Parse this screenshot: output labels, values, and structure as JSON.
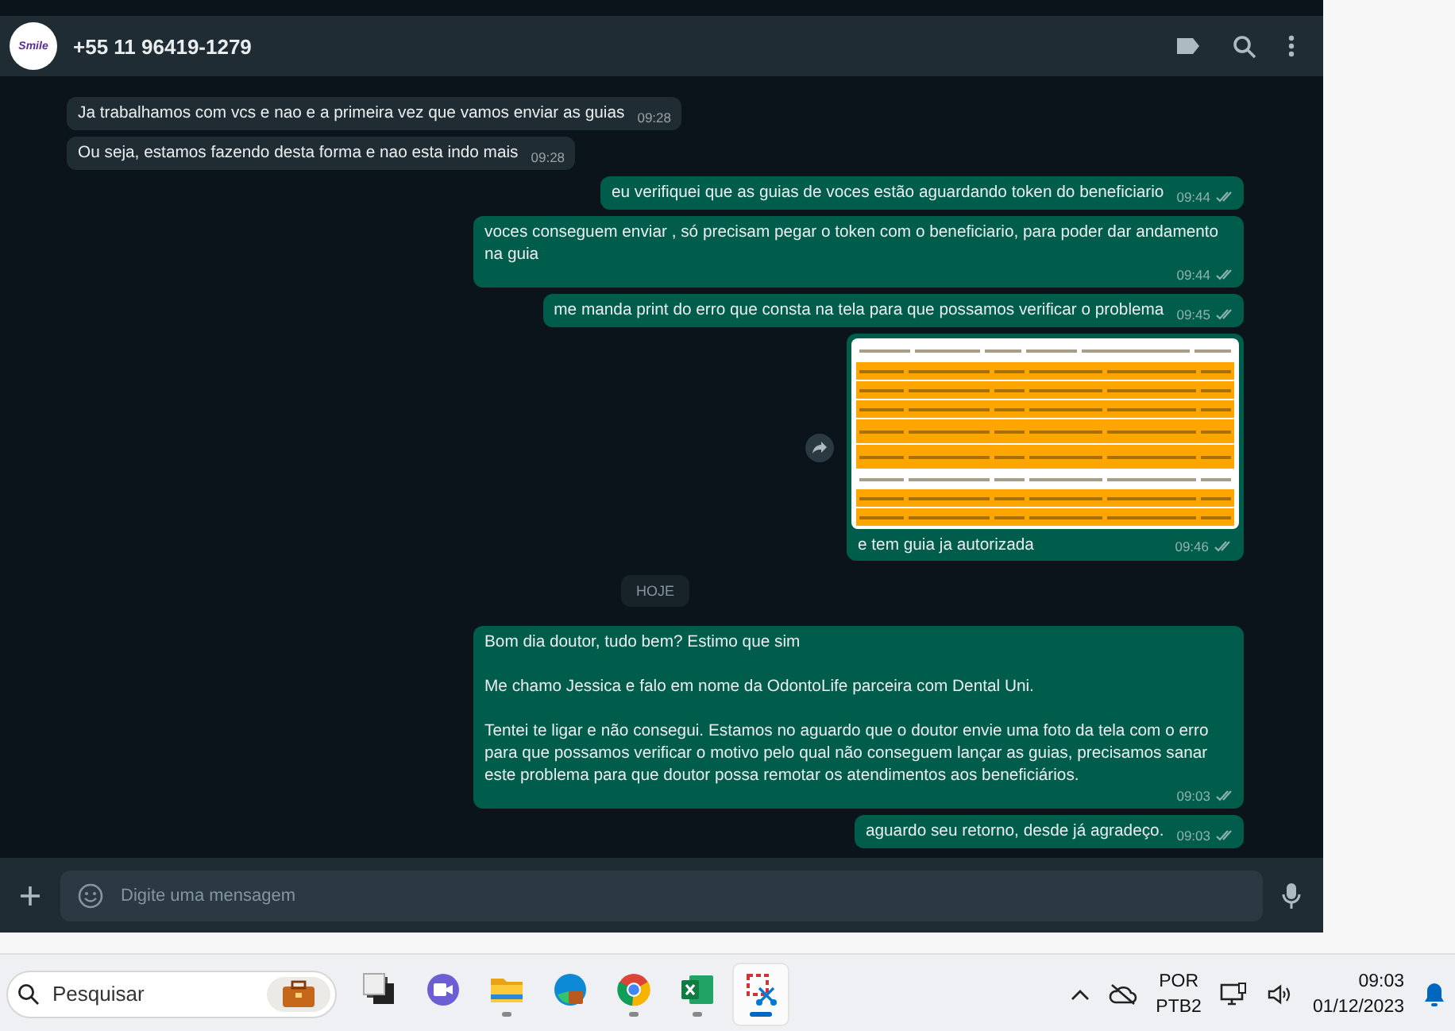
{
  "chat_header": {
    "avatar_text": "Smile",
    "title": "+55 11 96419-1279"
  },
  "messages": [
    {
      "kind": "text",
      "outgoing": false,
      "text": "Ja trabalhamos com vcs e nao e a primeira vez que vamos enviar as guias",
      "time": "09:28"
    },
    {
      "kind": "text",
      "outgoing": false,
      "text": "Ou seja, estamos fazendo desta forma e nao esta indo mais",
      "time": "09:28"
    },
    {
      "kind": "text",
      "outgoing": true,
      "text": "eu verifiquei que as guias de voces estão aguardando token do beneficiario",
      "time": "09:44",
      "read": false
    },
    {
      "kind": "text",
      "outgoing": true,
      "text": "voces conseguem enviar , só precisam pegar o token com o beneficiario, para poder dar andamento na guia",
      "time": "09:44",
      "read": false
    },
    {
      "kind": "text",
      "outgoing": true,
      "text": "me manda print do erro que consta na tela para que possamos verificar o problema",
      "time": "09:45",
      "read": false
    },
    {
      "kind": "image",
      "outgoing": true,
      "text": "e tem guia ja autorizada",
      "time": "09:46",
      "read": false,
      "thumbnail_rows": [
        {
          "highlighted": true
        },
        {
          "highlighted": true
        },
        {
          "highlighted": true
        },
        {
          "highlighted": true
        },
        {
          "highlighted": true
        },
        {
          "highlighted": false
        },
        {
          "highlighted": true
        },
        {
          "highlighted": true
        }
      ]
    },
    {
      "kind": "date",
      "text": "HOJE"
    },
    {
      "kind": "text",
      "outgoing": true,
      "text": "Bom dia doutor, tudo bem? Estimo que sim\n\nMe chamo Jessica e falo em nome da OdontoLife parceira com Dental Uni.\n\nTentei te ligar e não consegui. Estamos no aguardo que o doutor envie uma foto da tela com o erro para que possamos verificar o motivo pelo qual não conseguem lançar as guias, precisamos sanar este problema para que doutor possa remotar os atendimentos aos beneficiários.",
      "time": "09:03",
      "read": false
    },
    {
      "kind": "text",
      "outgoing": true,
      "text": "aguardo seu retorno, desde já agradeço.",
      "time": "09:03",
      "read": false
    }
  ],
  "composer": {
    "placeholder": "Digite uma mensagem"
  },
  "taskbar": {
    "search_placeholder": "Pesquisar",
    "apps": [
      {
        "kind": "desktop",
        "selected": false,
        "running": false
      },
      {
        "kind": "meet",
        "selected": false,
        "running": false
      },
      {
        "kind": "folder",
        "selected": false,
        "running": true
      },
      {
        "kind": "edge",
        "selected": false,
        "running": false
      },
      {
        "kind": "chrome",
        "selected": false,
        "running": true
      },
      {
        "kind": "excel",
        "selected": false,
        "running": true
      },
      {
        "kind": "snip",
        "selected": true,
        "running": true
      }
    ],
    "language": "POR",
    "layout": "PTB2",
    "time": "09:03",
    "date": "01/12/2023"
  }
}
